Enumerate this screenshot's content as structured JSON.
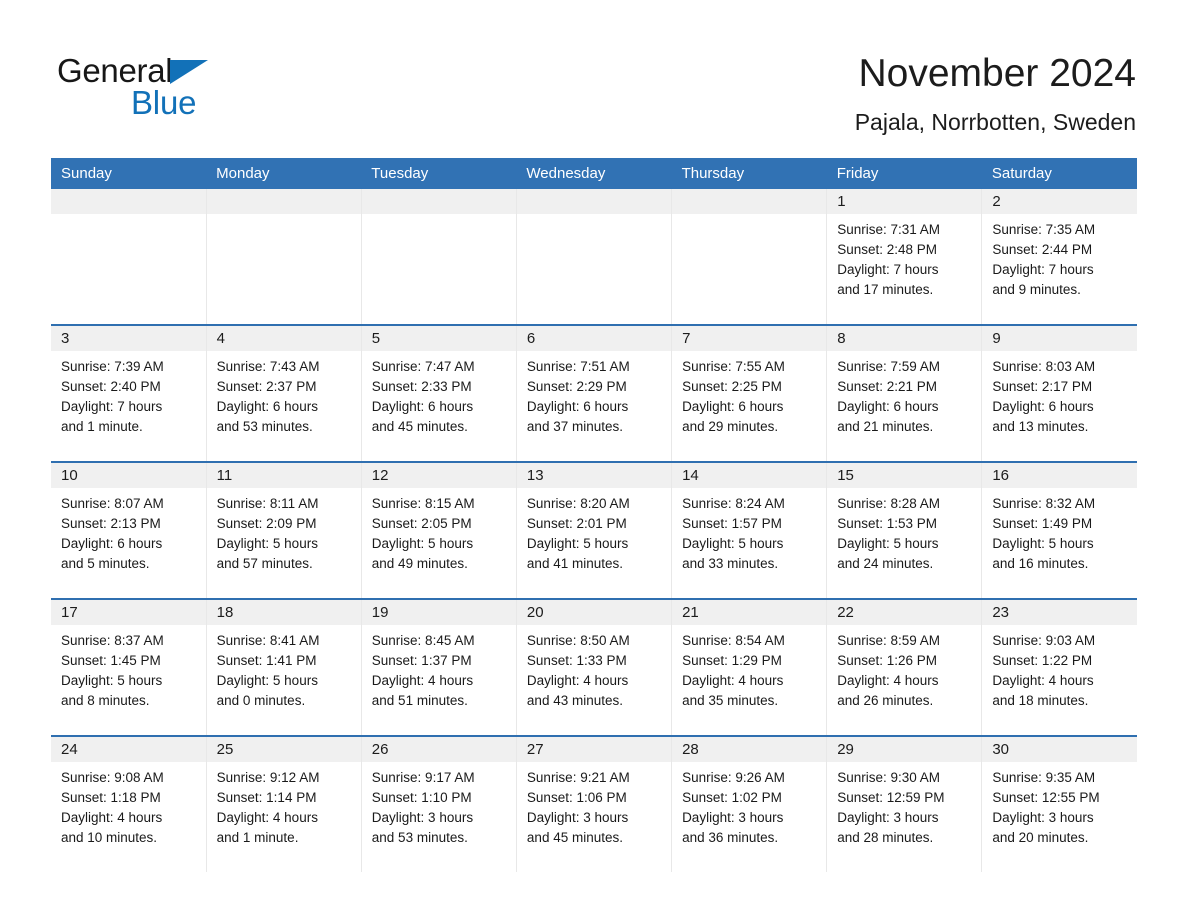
{
  "brand": {
    "name_part1": "General",
    "name_part2": "Blue",
    "accent_color": "#1271b8",
    "triangle_icon": "triangle-icon"
  },
  "header": {
    "title": "November 2024",
    "subtitle": "Pajala, Norrbotten, Sweden"
  },
  "colors": {
    "header_row_bg": "#3172b4",
    "header_row_text": "#ffffff",
    "row_separator": "#2f6fb0",
    "daynum_bg": "#f0f0f0",
    "cell_bg": "#ffffff",
    "text": "#1a1a1a"
  },
  "weekday_headers": [
    "Sunday",
    "Monday",
    "Tuesday",
    "Wednesday",
    "Thursday",
    "Friday",
    "Saturday"
  ],
  "weeks": [
    [
      {
        "day": "",
        "blank": true
      },
      {
        "day": "",
        "blank": true
      },
      {
        "day": "",
        "blank": true
      },
      {
        "day": "",
        "blank": true
      },
      {
        "day": "",
        "blank": true
      },
      {
        "day": "1",
        "sunrise": "Sunrise: 7:31 AM",
        "sunset": "Sunset: 2:48 PM",
        "daylight_line1": "Daylight: 7 hours",
        "daylight_line2": "and 17 minutes."
      },
      {
        "day": "2",
        "sunrise": "Sunrise: 7:35 AM",
        "sunset": "Sunset: 2:44 PM",
        "daylight_line1": "Daylight: 7 hours",
        "daylight_line2": "and 9 minutes."
      }
    ],
    [
      {
        "day": "3",
        "sunrise": "Sunrise: 7:39 AM",
        "sunset": "Sunset: 2:40 PM",
        "daylight_line1": "Daylight: 7 hours",
        "daylight_line2": "and 1 minute."
      },
      {
        "day": "4",
        "sunrise": "Sunrise: 7:43 AM",
        "sunset": "Sunset: 2:37 PM",
        "daylight_line1": "Daylight: 6 hours",
        "daylight_line2": "and 53 minutes."
      },
      {
        "day": "5",
        "sunrise": "Sunrise: 7:47 AM",
        "sunset": "Sunset: 2:33 PM",
        "daylight_line1": "Daylight: 6 hours",
        "daylight_line2": "and 45 minutes."
      },
      {
        "day": "6",
        "sunrise": "Sunrise: 7:51 AM",
        "sunset": "Sunset: 2:29 PM",
        "daylight_line1": "Daylight: 6 hours",
        "daylight_line2": "and 37 minutes."
      },
      {
        "day": "7",
        "sunrise": "Sunrise: 7:55 AM",
        "sunset": "Sunset: 2:25 PM",
        "daylight_line1": "Daylight: 6 hours",
        "daylight_line2": "and 29 minutes."
      },
      {
        "day": "8",
        "sunrise": "Sunrise: 7:59 AM",
        "sunset": "Sunset: 2:21 PM",
        "daylight_line1": "Daylight: 6 hours",
        "daylight_line2": "and 21 minutes."
      },
      {
        "day": "9",
        "sunrise": "Sunrise: 8:03 AM",
        "sunset": "Sunset: 2:17 PM",
        "daylight_line1": "Daylight: 6 hours",
        "daylight_line2": "and 13 minutes."
      }
    ],
    [
      {
        "day": "10",
        "sunrise": "Sunrise: 8:07 AM",
        "sunset": "Sunset: 2:13 PM",
        "daylight_line1": "Daylight: 6 hours",
        "daylight_line2": "and 5 minutes."
      },
      {
        "day": "11",
        "sunrise": "Sunrise: 8:11 AM",
        "sunset": "Sunset: 2:09 PM",
        "daylight_line1": "Daylight: 5 hours",
        "daylight_line2": "and 57 minutes."
      },
      {
        "day": "12",
        "sunrise": "Sunrise: 8:15 AM",
        "sunset": "Sunset: 2:05 PM",
        "daylight_line1": "Daylight: 5 hours",
        "daylight_line2": "and 49 minutes."
      },
      {
        "day": "13",
        "sunrise": "Sunrise: 8:20 AM",
        "sunset": "Sunset: 2:01 PM",
        "daylight_line1": "Daylight: 5 hours",
        "daylight_line2": "and 41 minutes."
      },
      {
        "day": "14",
        "sunrise": "Sunrise: 8:24 AM",
        "sunset": "Sunset: 1:57 PM",
        "daylight_line1": "Daylight: 5 hours",
        "daylight_line2": "and 33 minutes."
      },
      {
        "day": "15",
        "sunrise": "Sunrise: 8:28 AM",
        "sunset": "Sunset: 1:53 PM",
        "daylight_line1": "Daylight: 5 hours",
        "daylight_line2": "and 24 minutes."
      },
      {
        "day": "16",
        "sunrise": "Sunrise: 8:32 AM",
        "sunset": "Sunset: 1:49 PM",
        "daylight_line1": "Daylight: 5 hours",
        "daylight_line2": "and 16 minutes."
      }
    ],
    [
      {
        "day": "17",
        "sunrise": "Sunrise: 8:37 AM",
        "sunset": "Sunset: 1:45 PM",
        "daylight_line1": "Daylight: 5 hours",
        "daylight_line2": "and 8 minutes."
      },
      {
        "day": "18",
        "sunrise": "Sunrise: 8:41 AM",
        "sunset": "Sunset: 1:41 PM",
        "daylight_line1": "Daylight: 5 hours",
        "daylight_line2": "and 0 minutes."
      },
      {
        "day": "19",
        "sunrise": "Sunrise: 8:45 AM",
        "sunset": "Sunset: 1:37 PM",
        "daylight_line1": "Daylight: 4 hours",
        "daylight_line2": "and 51 minutes."
      },
      {
        "day": "20",
        "sunrise": "Sunrise: 8:50 AM",
        "sunset": "Sunset: 1:33 PM",
        "daylight_line1": "Daylight: 4 hours",
        "daylight_line2": "and 43 minutes."
      },
      {
        "day": "21",
        "sunrise": "Sunrise: 8:54 AM",
        "sunset": "Sunset: 1:29 PM",
        "daylight_line1": "Daylight: 4 hours",
        "daylight_line2": "and 35 minutes."
      },
      {
        "day": "22",
        "sunrise": "Sunrise: 8:59 AM",
        "sunset": "Sunset: 1:26 PM",
        "daylight_line1": "Daylight: 4 hours",
        "daylight_line2": "and 26 minutes."
      },
      {
        "day": "23",
        "sunrise": "Sunrise: 9:03 AM",
        "sunset": "Sunset: 1:22 PM",
        "daylight_line1": "Daylight: 4 hours",
        "daylight_line2": "and 18 minutes."
      }
    ],
    [
      {
        "day": "24",
        "sunrise": "Sunrise: 9:08 AM",
        "sunset": "Sunset: 1:18 PM",
        "daylight_line1": "Daylight: 4 hours",
        "daylight_line2": "and 10 minutes."
      },
      {
        "day": "25",
        "sunrise": "Sunrise: 9:12 AM",
        "sunset": "Sunset: 1:14 PM",
        "daylight_line1": "Daylight: 4 hours",
        "daylight_line2": "and 1 minute."
      },
      {
        "day": "26",
        "sunrise": "Sunrise: 9:17 AM",
        "sunset": "Sunset: 1:10 PM",
        "daylight_line1": "Daylight: 3 hours",
        "daylight_line2": "and 53 minutes."
      },
      {
        "day": "27",
        "sunrise": "Sunrise: 9:21 AM",
        "sunset": "Sunset: 1:06 PM",
        "daylight_line1": "Daylight: 3 hours",
        "daylight_line2": "and 45 minutes."
      },
      {
        "day": "28",
        "sunrise": "Sunrise: 9:26 AM",
        "sunset": "Sunset: 1:02 PM",
        "daylight_line1": "Daylight: 3 hours",
        "daylight_line2": "and 36 minutes."
      },
      {
        "day": "29",
        "sunrise": "Sunrise: 9:30 AM",
        "sunset": "Sunset: 12:59 PM",
        "daylight_line1": "Daylight: 3 hours",
        "daylight_line2": "and 28 minutes."
      },
      {
        "day": "30",
        "sunrise": "Sunrise: 9:35 AM",
        "sunset": "Sunset: 12:55 PM",
        "daylight_line1": "Daylight: 3 hours",
        "daylight_line2": "and 20 minutes."
      }
    ]
  ]
}
